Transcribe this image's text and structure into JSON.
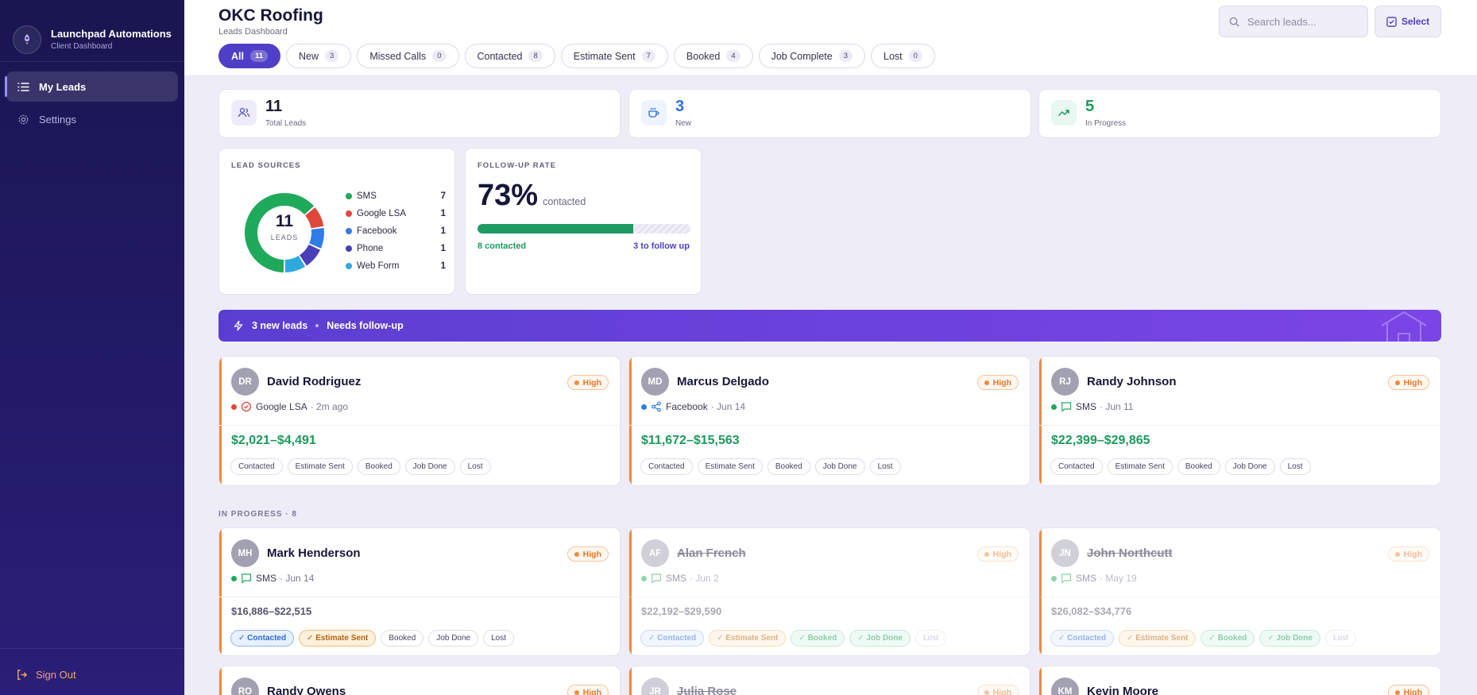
{
  "app": {
    "name": "Launchpad Automations",
    "subtitle": "Client Dashboard"
  },
  "sidebar": {
    "items": [
      {
        "label": "My Leads",
        "icon": "list-icon",
        "active": true
      },
      {
        "label": "Settings",
        "icon": "gear-icon",
        "active": false
      }
    ],
    "signout": "Sign Out"
  },
  "header": {
    "title": "OKC Roofing",
    "subtitle": "Leads Dashboard",
    "search_placeholder": "Search leads...",
    "select_label": "Select"
  },
  "tabs": [
    {
      "label": "All",
      "count": "11",
      "active": true
    },
    {
      "label": "New",
      "count": "3"
    },
    {
      "label": "Missed Calls",
      "count": "0"
    },
    {
      "label": "Contacted",
      "count": "8"
    },
    {
      "label": "Estimate Sent",
      "count": "7"
    },
    {
      "label": "Booked",
      "count": "4"
    },
    {
      "label": "Job Complete",
      "count": "3"
    },
    {
      "label": "Lost",
      "count": "0"
    }
  ],
  "stats": [
    {
      "value": "11",
      "label": "Total Leads",
      "color": "#16163a",
      "icon": "users-icon"
    },
    {
      "value": "3",
      "label": "New",
      "color": "#2e6fd8",
      "icon": "coffee-cup-icon"
    },
    {
      "value": "5",
      "label": "In Progress",
      "color": "#1c9a5c",
      "icon": "trending-up-icon"
    }
  ],
  "lead_sources": {
    "title": "LEAD SOURCES",
    "total": "11",
    "total_label": "LEADS",
    "chart_data": {
      "type": "pie",
      "categories": [
        "SMS",
        "Google LSA",
        "Facebook",
        "Phone",
        "Web Form"
      ],
      "values": [
        7,
        1,
        1,
        1,
        1
      ],
      "colors": [
        "#1fa95b",
        "#e0473b",
        "#2f7ce6",
        "#4a3fb8",
        "#2fa8e0"
      ]
    }
  },
  "followup": {
    "title": "FOLLOW-UP RATE",
    "percent": "73%",
    "percent_value": 73,
    "suffix": "contacted",
    "contacted_label": "8 contacted",
    "followup_label": "3 to follow up"
  },
  "banner": {
    "new_leads": "3 new leads",
    "needs": "Needs follow-up"
  },
  "in_progress_title": "IN PROGRESS · 8",
  "leads_new": [
    {
      "initials": "DR",
      "name": "David Rodriguez",
      "priority": "High",
      "source": "Google LSA",
      "source_color": "#e0473b",
      "source_icon": "google-badge-icon",
      "time": "· 2m ago",
      "price": "$2,021–$4,491",
      "steps": [
        "Contacted",
        "Estimate Sent",
        "Booked",
        "Job Done",
        "Lost"
      ]
    },
    {
      "initials": "MD",
      "name": "Marcus Delgado",
      "priority": "High",
      "source": "Facebook",
      "source_color": "#2f7ce6",
      "source_icon": "share-icon",
      "time": "· Jun 14",
      "price": "$11,672–$15,563",
      "steps": [
        "Contacted",
        "Estimate Sent",
        "Booked",
        "Job Done",
        "Lost"
      ]
    },
    {
      "initials": "RJ",
      "name": "Randy Johnson",
      "priority": "High",
      "source": "SMS",
      "source_color": "#1fa95b",
      "source_icon": "message-icon",
      "time": "· Jun 11",
      "price": "$22,399–$29,865",
      "steps": [
        "Contacted",
        "Estimate Sent",
        "Booked",
        "Job Done",
        "Lost"
      ]
    }
  ],
  "leads_progress": [
    {
      "initials": "MH",
      "name": "Mark Henderson",
      "priority": "High",
      "source": "SMS",
      "source_color": "#1fa95b",
      "time": "· Jun 14",
      "price": "$16,886–$22,515",
      "steps": [
        "Contacted",
        "Estimate Sent",
        "Booked",
        "Job Done",
        "Lost"
      ],
      "step_state": [
        "blue",
        "orange",
        "",
        "",
        ""
      ],
      "faded": false
    },
    {
      "initials": "AF",
      "name": "Alan French",
      "priority": "High",
      "source": "SMS",
      "source_color": "#1fa95b",
      "time": "· Jun 2",
      "price": "$22,192–$29,590",
      "steps": [
        "Contacted",
        "Estimate Sent",
        "Booked",
        "Job Done",
        "Lost"
      ],
      "step_state": [
        "blue",
        "orange",
        "green",
        "green",
        "lostx"
      ],
      "faded": true
    },
    {
      "initials": "JN",
      "name": "John Northcutt",
      "priority": "High",
      "source": "SMS",
      "source_color": "#1fa95b",
      "time": "· May 19",
      "price": "$26,082–$34,776",
      "steps": [
        "Contacted",
        "Estimate Sent",
        "Booked",
        "Job Done",
        "Lost"
      ],
      "step_state": [
        "blue",
        "orange",
        "green",
        "green",
        "lostx"
      ],
      "faded": true
    }
  ],
  "leads_row3": [
    {
      "initials": "RO",
      "name": "Randy Owens",
      "priority": "High",
      "faded": false
    },
    {
      "initials": "JR",
      "name": "Julia Rose",
      "priority": "High",
      "faded": true
    },
    {
      "initials": "KM",
      "name": "Kevin Moore",
      "priority": "High",
      "faded": false
    }
  ]
}
